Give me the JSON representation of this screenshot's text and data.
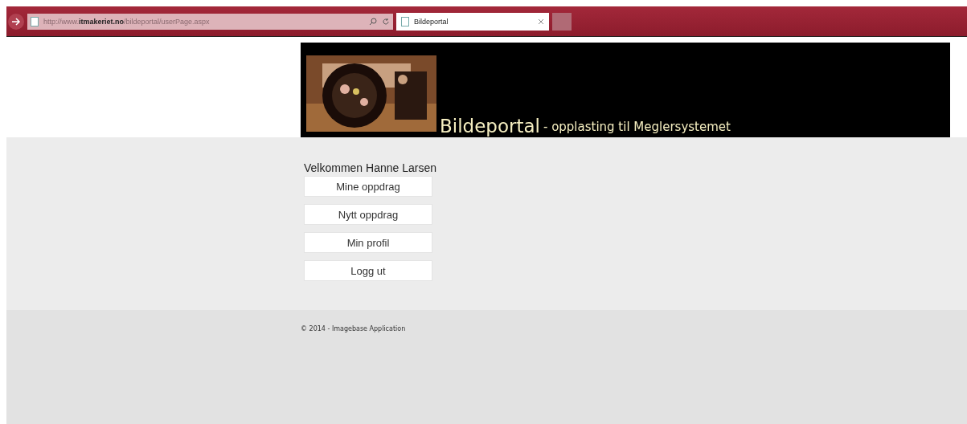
{
  "browser": {
    "address": "http://www.**itmakeriet.no**/bildeportal/userPage.aspx",
    "tabs": [
      {
        "title": "Bildeportal",
        "selected": true
      }
    ]
  },
  "header": {
    "title": "Bildeportal",
    "subtitle": "- opplasting til Meglersystemet"
  },
  "welcome": "Velkommen Hanne Larsen",
  "menu": [
    "Mine oppdrag",
    "Nytt oppdrag",
    "Min profil",
    "Logg ut"
  ],
  "footer": "© 2014 - Imagebase Application"
}
